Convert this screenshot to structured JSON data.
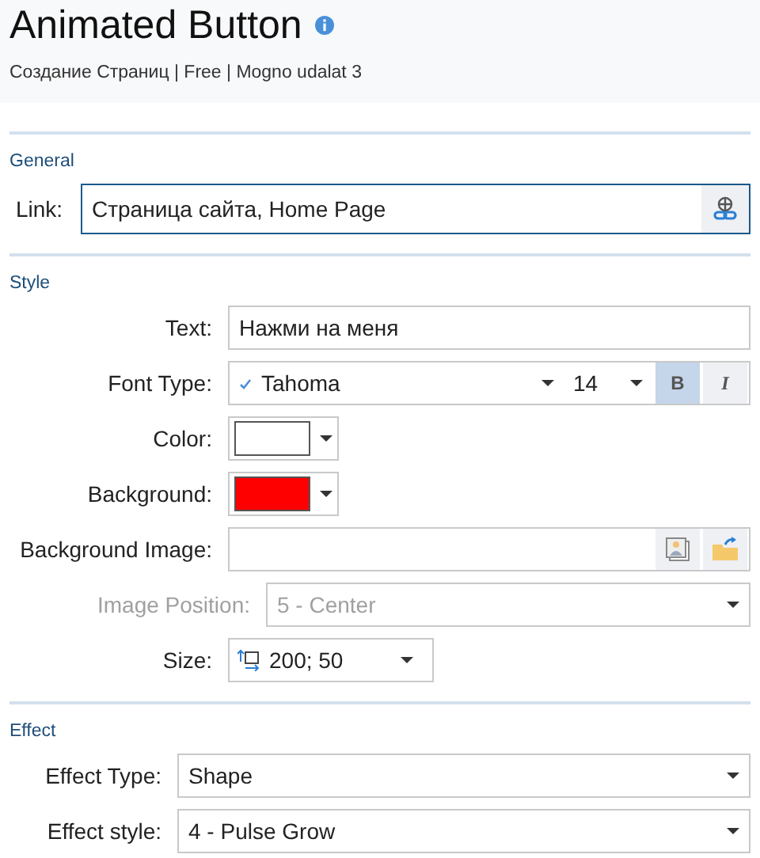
{
  "header": {
    "title": "Animated Button",
    "subtitle": "Создание Страниц | Free | Mogno udalat 3"
  },
  "sections": [
    {
      "title": "General",
      "fields": [
        {
          "kind": "link",
          "label": "Link:",
          "value": "Страница сайта, Home Page"
        }
      ]
    },
    {
      "title": "Style",
      "fields": [
        {
          "kind": "text",
          "label": "Text:",
          "value": "Нажми на меня"
        },
        {
          "kind": "font",
          "label": "Font Type:",
          "font": "Tahoma",
          "size": "14",
          "bold_label": "B",
          "bold": true,
          "italic_label": "I",
          "italic": false
        },
        {
          "kind": "color",
          "label": "Color:",
          "color": "#ffffff"
        },
        {
          "kind": "color",
          "label": "Background:",
          "color": "#ff0000"
        },
        {
          "kind": "image",
          "label": "Background Image:"
        },
        {
          "kind": "select",
          "label": "Image Position:",
          "value": "5 - Center",
          "disabled": true
        },
        {
          "kind": "size",
          "label": "Size:",
          "value": "200; 50"
        }
      ]
    },
    {
      "title": "Effect",
      "fields": [
        {
          "kind": "select",
          "label": "Effect Type:",
          "value": "Shape"
        },
        {
          "kind": "select",
          "label": "Effect style:",
          "value": "4 - Pulse Grow"
        }
      ]
    }
  ]
}
